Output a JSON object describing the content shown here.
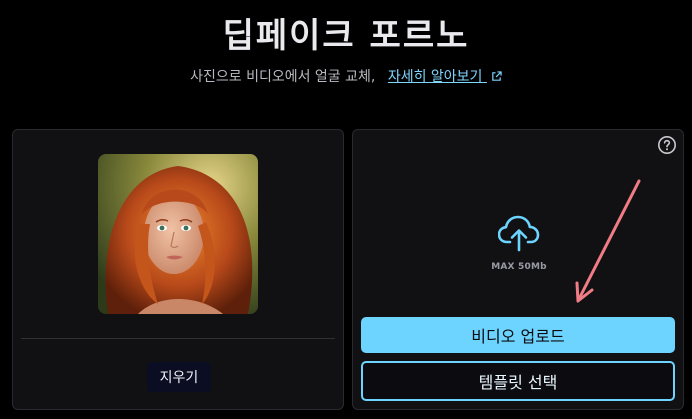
{
  "header": {
    "title": "딥페이크 포르노",
    "subtitle": "사진으로 비디오에서 얼굴 교체,",
    "learn_more_link": "자세히 알아보기",
    "external_link_icon": "external-link-icon"
  },
  "left_panel": {
    "photo_icon": "face-photo",
    "clear_label": "지우기"
  },
  "right_panel": {
    "help_icon": "question-circle-icon",
    "upload_icon": "cloud-upload-icon",
    "max_size": "MAX 50Mb",
    "upload_video_label": "비디오 업로드",
    "select_template_label": "템플릿 선택"
  },
  "colors": {
    "background": "#000000",
    "panel": "#111114",
    "accent": "#6cd4ff",
    "link": "#7fd6ff",
    "annotation_arrow": "#f07c85"
  }
}
